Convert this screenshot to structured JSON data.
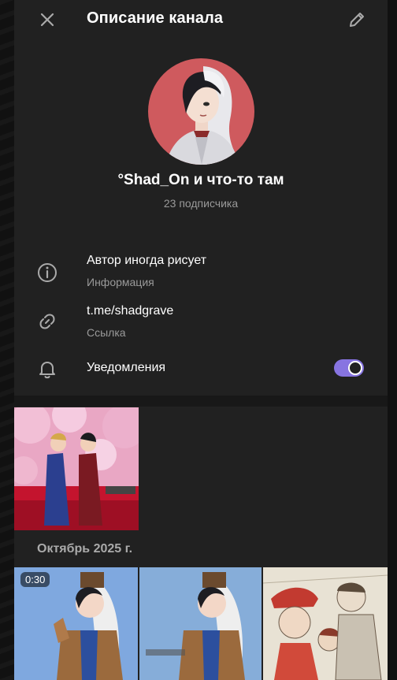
{
  "header": {
    "title": "Описание канала",
    "close_icon": "close-icon",
    "edit_icon": "pencil-icon"
  },
  "channel": {
    "name": "°Shad_On и что-то там",
    "subscribers": "23 подписчика",
    "avatar_color": "#cf5a5e"
  },
  "info": {
    "description": "Автор иногда рисует",
    "description_caption": "Информация",
    "link": "t.me/shadgrave",
    "link_caption": "Ссылка",
    "notifications_label": "Уведомления",
    "notifications_on": true
  },
  "media": {
    "month_label": "Октябрь 2025 г.",
    "video_duration": "0:30"
  },
  "colors": {
    "panel_bg": "#212121",
    "accent": "#8774e1",
    "secondary_text": "#9a9a9a"
  }
}
